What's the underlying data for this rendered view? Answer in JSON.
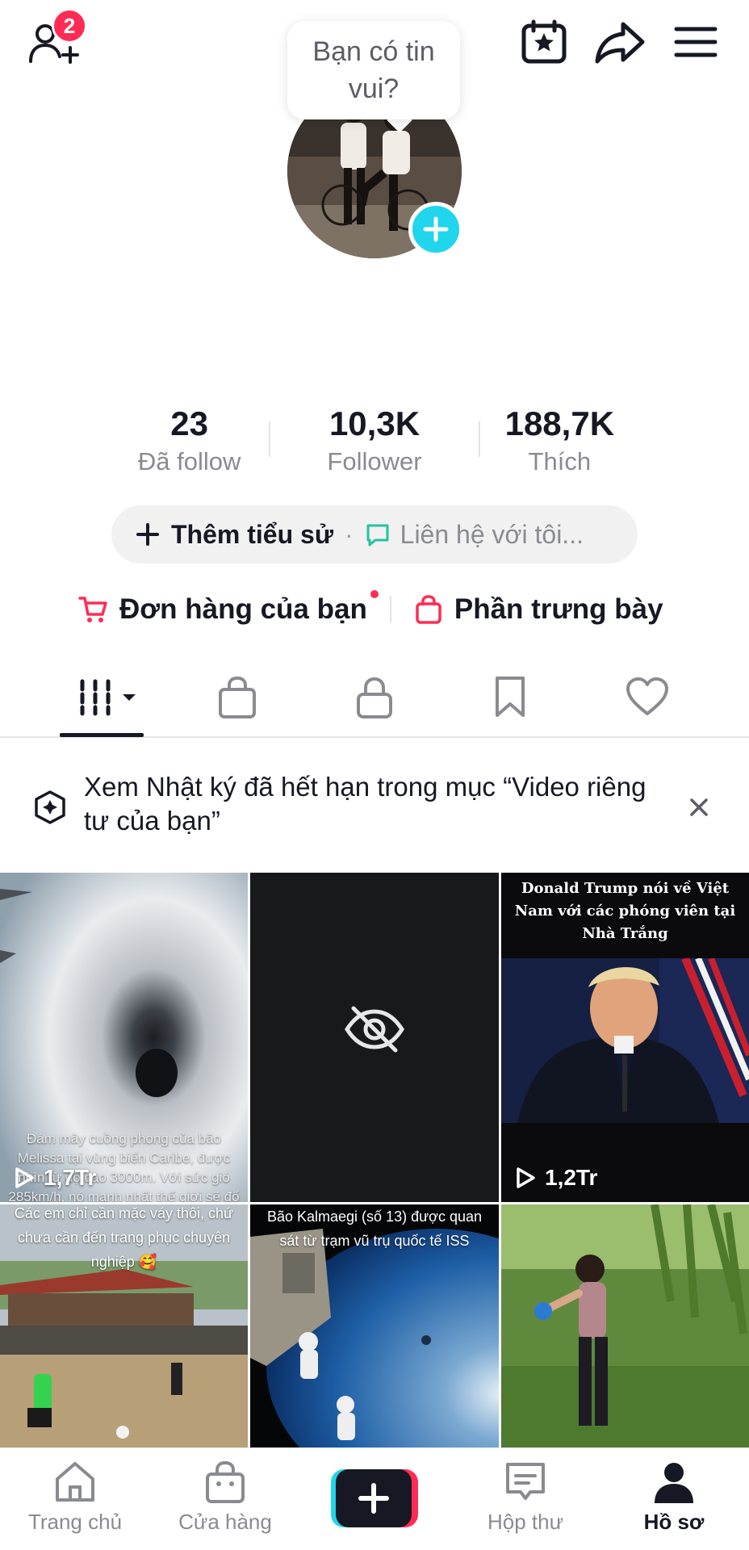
{
  "topbar": {
    "friend_requests_badge": "2",
    "bubble_text": "Bạn có tin vui?"
  },
  "profile": {
    "stats": [
      {
        "value": "23",
        "label": "Đã follow"
      },
      {
        "value": "10,3K",
        "label": "Follower"
      },
      {
        "value": "188,7K",
        "label": "Thích"
      }
    ],
    "bio_add_label": "Thêm tiểu sử",
    "bio_separator": "·",
    "contact_label": "Liên hệ với tôi..."
  },
  "shop": {
    "orders_label": "Đơn hàng của bạn",
    "showcase_label": "Phần trưng bày"
  },
  "tabs": [
    "videos-grid",
    "shop",
    "private",
    "saved",
    "liked"
  ],
  "notice": {
    "text": "Xem Nhật ký đã hết hạn trong mục “Video riêng tư của bạn”"
  },
  "videos": [
    {
      "caption": "Đám mây cuồng phong của bão Melissa tại vùng biển Caribe, được nhìn từ độ cao 3000m. Với sức gió 285km/h, nó mạnh nhất thế giới sẽ đổ bộ vào đất liền Cu Ba và",
      "views": "1,7Tr"
    },
    {
      "caption": "",
      "views": ""
    },
    {
      "caption": "Donald Trump nói về Việt Nam với các phóng viên tại Nhà Trắng",
      "views": "1,2Tr"
    },
    {
      "caption": "Các em chỉ cần mặc váy thôi, chứ chưa cần đến trang phục chuyên nghiệp 🥰",
      "views": ""
    },
    {
      "caption": "Bão Kalmaegi (số 13) được quan sát từ trạm vũ trụ quốc tế ISS",
      "views": ""
    },
    {
      "caption": "",
      "views": ""
    }
  ],
  "bottom_nav": {
    "home": "Trang chủ",
    "shop": "Cửa hàng",
    "inbox": "Hộp thư",
    "profile": "Hồ sơ"
  },
  "colors": {
    "accent": "#fe2c55",
    "cyan": "#20d5ec",
    "text": "#161823",
    "muted": "#8a8b91"
  }
}
